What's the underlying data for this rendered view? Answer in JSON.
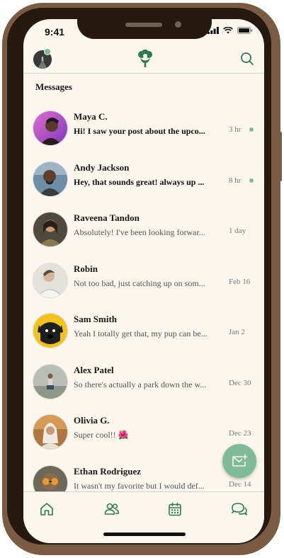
{
  "status_bar": {
    "time": "9:41"
  },
  "header": {
    "profile_icon": "profile-avatar",
    "logo_icon": "flower-logo-icon",
    "search_icon": "search-icon"
  },
  "section_title": "Messages",
  "messages": [
    {
      "name": "Maya C.",
      "preview": "Hi! I saw your post about the upco...",
      "time": "3 hr",
      "unread": true
    },
    {
      "name": "Andy Jackson",
      "preview": "Hey, that sounds great! always up ...",
      "time": "8 hr",
      "unread": true
    },
    {
      "name": "Raveena Tandon",
      "preview": "Absolutely! I've been looking forwar...",
      "time": "1 day",
      "unread": false
    },
    {
      "name": "Robin",
      "preview": "Not too bad, just catching up on som...",
      "time": "Feb 16",
      "unread": false
    },
    {
      "name": "Sam Smith",
      "preview": "Yeah I totally get that, my pup can be...",
      "time": "Jan 2",
      "unread": false
    },
    {
      "name": "Alex Patel",
      "preview": "So there's actually a park down the w...",
      "time": "Dec 30",
      "unread": false
    },
    {
      "name": "Olivia G.",
      "preview": "Super cool!! 🌺",
      "time": "Dec 23",
      "unread": false
    },
    {
      "name": "Ethan Rodriguez",
      "preview": "It wasn't my favorite but I would def...",
      "time": "Dec 14",
      "unread": false
    }
  ],
  "fab_icon": "compose-mail-icon",
  "tabs": [
    {
      "icon": "home-icon"
    },
    {
      "icon": "people-icon"
    },
    {
      "icon": "calendar-icon"
    },
    {
      "icon": "chat-bubbles-icon"
    }
  ],
  "colors": {
    "accent": "#7fbb98",
    "brand_green": "#2e7a4f",
    "background": "#fbf6ee",
    "frame": "#7a5c44"
  }
}
